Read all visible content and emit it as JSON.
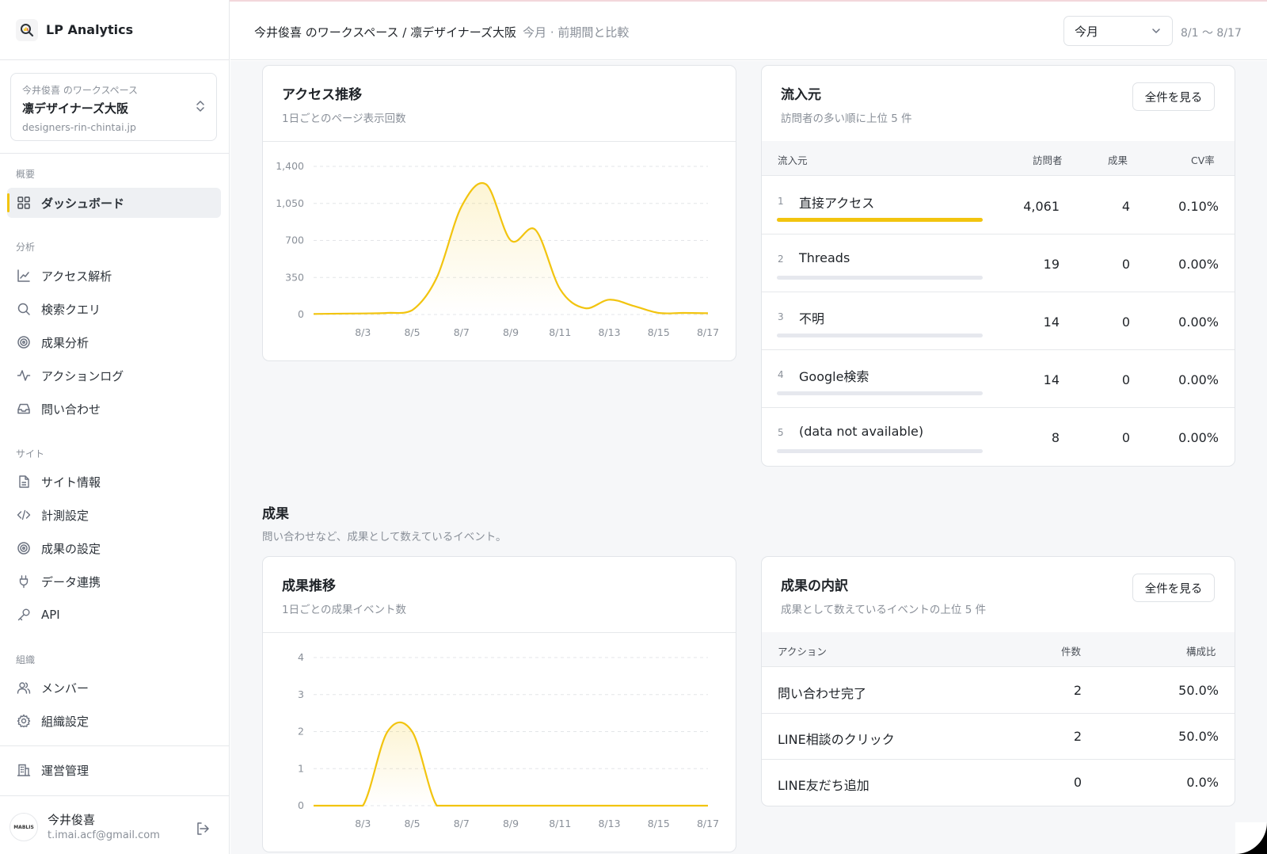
{
  "app": {
    "name": "LP Analytics"
  },
  "workspace": {
    "label": "今井俊喜 のワークスペース",
    "name": "凛デザイナーズ大阪",
    "domain": "designers-rin-chintai.jp"
  },
  "nav": {
    "sections": {
      "overview": "概要",
      "analysis": "分析",
      "site": "サイト",
      "org": "組織"
    },
    "items": {
      "dashboard": "ダッシュボード",
      "access": "アクセス解析",
      "search": "検索クエリ",
      "conversion": "成果分析",
      "actionlog": "アクションログ",
      "inquiry": "問い合わせ",
      "siteinfo": "サイト情報",
      "tracking": "計測設定",
      "goals": "成果の設定",
      "integration": "データ連携",
      "api": "API",
      "members": "メンバー",
      "orgsettings": "組織設定",
      "admin": "運営管理"
    }
  },
  "user": {
    "name": "今井俊喜",
    "email": "t.imai.acf@gmail.com",
    "avatar_text": "MABLIS"
  },
  "header": {
    "breadcrumb": "今井俊喜 のワークスペース / 凛デザイナーズ大阪",
    "compare": "今月 · 前期間と比較",
    "period": "今月",
    "date_range": "8/1 〜 8/17"
  },
  "access_card": {
    "title": "アクセス推移",
    "subtitle": "1日ごとのページ表示回数"
  },
  "sources_card": {
    "title": "流入元",
    "subtitle": "訪問者の多い順に上位 5 件",
    "button": "全件を見る",
    "columns": {
      "source": "流入元",
      "visitors": "訪問者",
      "conv": "成果",
      "cvr": "CV率"
    },
    "rows": [
      {
        "rank": "1",
        "name": "直接アクセス",
        "visitors": "4,061",
        "conv": "4",
        "cvr": "0.10%",
        "share": 1.0
      },
      {
        "rank": "2",
        "name": "Threads",
        "visitors": "19",
        "conv": "0",
        "cvr": "0.00%",
        "share": 0.0
      },
      {
        "rank": "3",
        "name": "不明",
        "visitors": "14",
        "conv": "0",
        "cvr": "0.00%",
        "share": 0.0
      },
      {
        "rank": "4",
        "name": "Google検索",
        "visitors": "14",
        "conv": "0",
        "cvr": "0.00%",
        "share": 0.0
      },
      {
        "rank": "5",
        "name": "(data not available)",
        "visitors": "8",
        "conv": "0",
        "cvr": "0.00%",
        "share": 0.0
      }
    ]
  },
  "section": {
    "title": "成果",
    "subtitle": "問い合わせなど、成果として数えているイベント。"
  },
  "conv_card": {
    "title": "成果推移",
    "subtitle": "1日ごとの成果イベント数"
  },
  "breakdown_card": {
    "title": "成果の内訳",
    "subtitle": "成果として数えているイベントの上位 5 件",
    "button": "全件を見る",
    "columns": {
      "action": "アクション",
      "count": "件数",
      "ratio": "構成比"
    },
    "rows": [
      {
        "action": "問い合わせ完了",
        "count": "2",
        "ratio": "50.0%"
      },
      {
        "action": "LINE相談のクリック",
        "count": "2",
        "ratio": "50.0%"
      },
      {
        "action": "LINE友だち追加",
        "count": "0",
        "ratio": "0.0%"
      }
    ]
  },
  "colors": {
    "accent": "#f2c40f",
    "grid": "#e3e5e8",
    "axis_text": "#8a9099"
  },
  "chart_data": [
    {
      "type": "area",
      "x": [
        "8/1",
        "8/2",
        "8/3",
        "8/4",
        "8/5",
        "8/6",
        "8/7",
        "8/8",
        "8/9",
        "8/10",
        "8/11",
        "8/12",
        "8/13",
        "8/14",
        "8/15",
        "8/16",
        "8/17"
      ],
      "y": [
        5,
        8,
        10,
        15,
        40,
        350,
        1020,
        1230,
        700,
        800,
        240,
        60,
        140,
        80,
        15,
        15,
        12
      ],
      "ylim": [
        0,
        1400
      ],
      "yticks": [
        0,
        350,
        700,
        1050,
        1400
      ],
      "xticks": [
        "8/3",
        "8/5",
        "8/7",
        "8/9",
        "8/11",
        "8/13",
        "8/15",
        "8/17"
      ],
      "grid": true
    },
    {
      "type": "area",
      "x": [
        "8/1",
        "8/2",
        "8/3",
        "8/4",
        "8/5",
        "8/6",
        "8/7",
        "8/8",
        "8/9",
        "8/10",
        "8/11",
        "8/12",
        "8/13",
        "8/14",
        "8/15",
        "8/16",
        "8/17"
      ],
      "y": [
        0,
        0,
        0,
        2,
        2,
        0,
        0,
        0,
        0,
        0,
        0,
        0,
        0,
        0,
        0,
        0,
        0
      ],
      "ylim": [
        0,
        4
      ],
      "yticks": [
        0,
        1,
        2,
        3,
        4
      ],
      "xticks": [
        "8/3",
        "8/5",
        "8/7",
        "8/9",
        "8/11",
        "8/13",
        "8/15",
        "8/17"
      ],
      "grid": true
    }
  ]
}
